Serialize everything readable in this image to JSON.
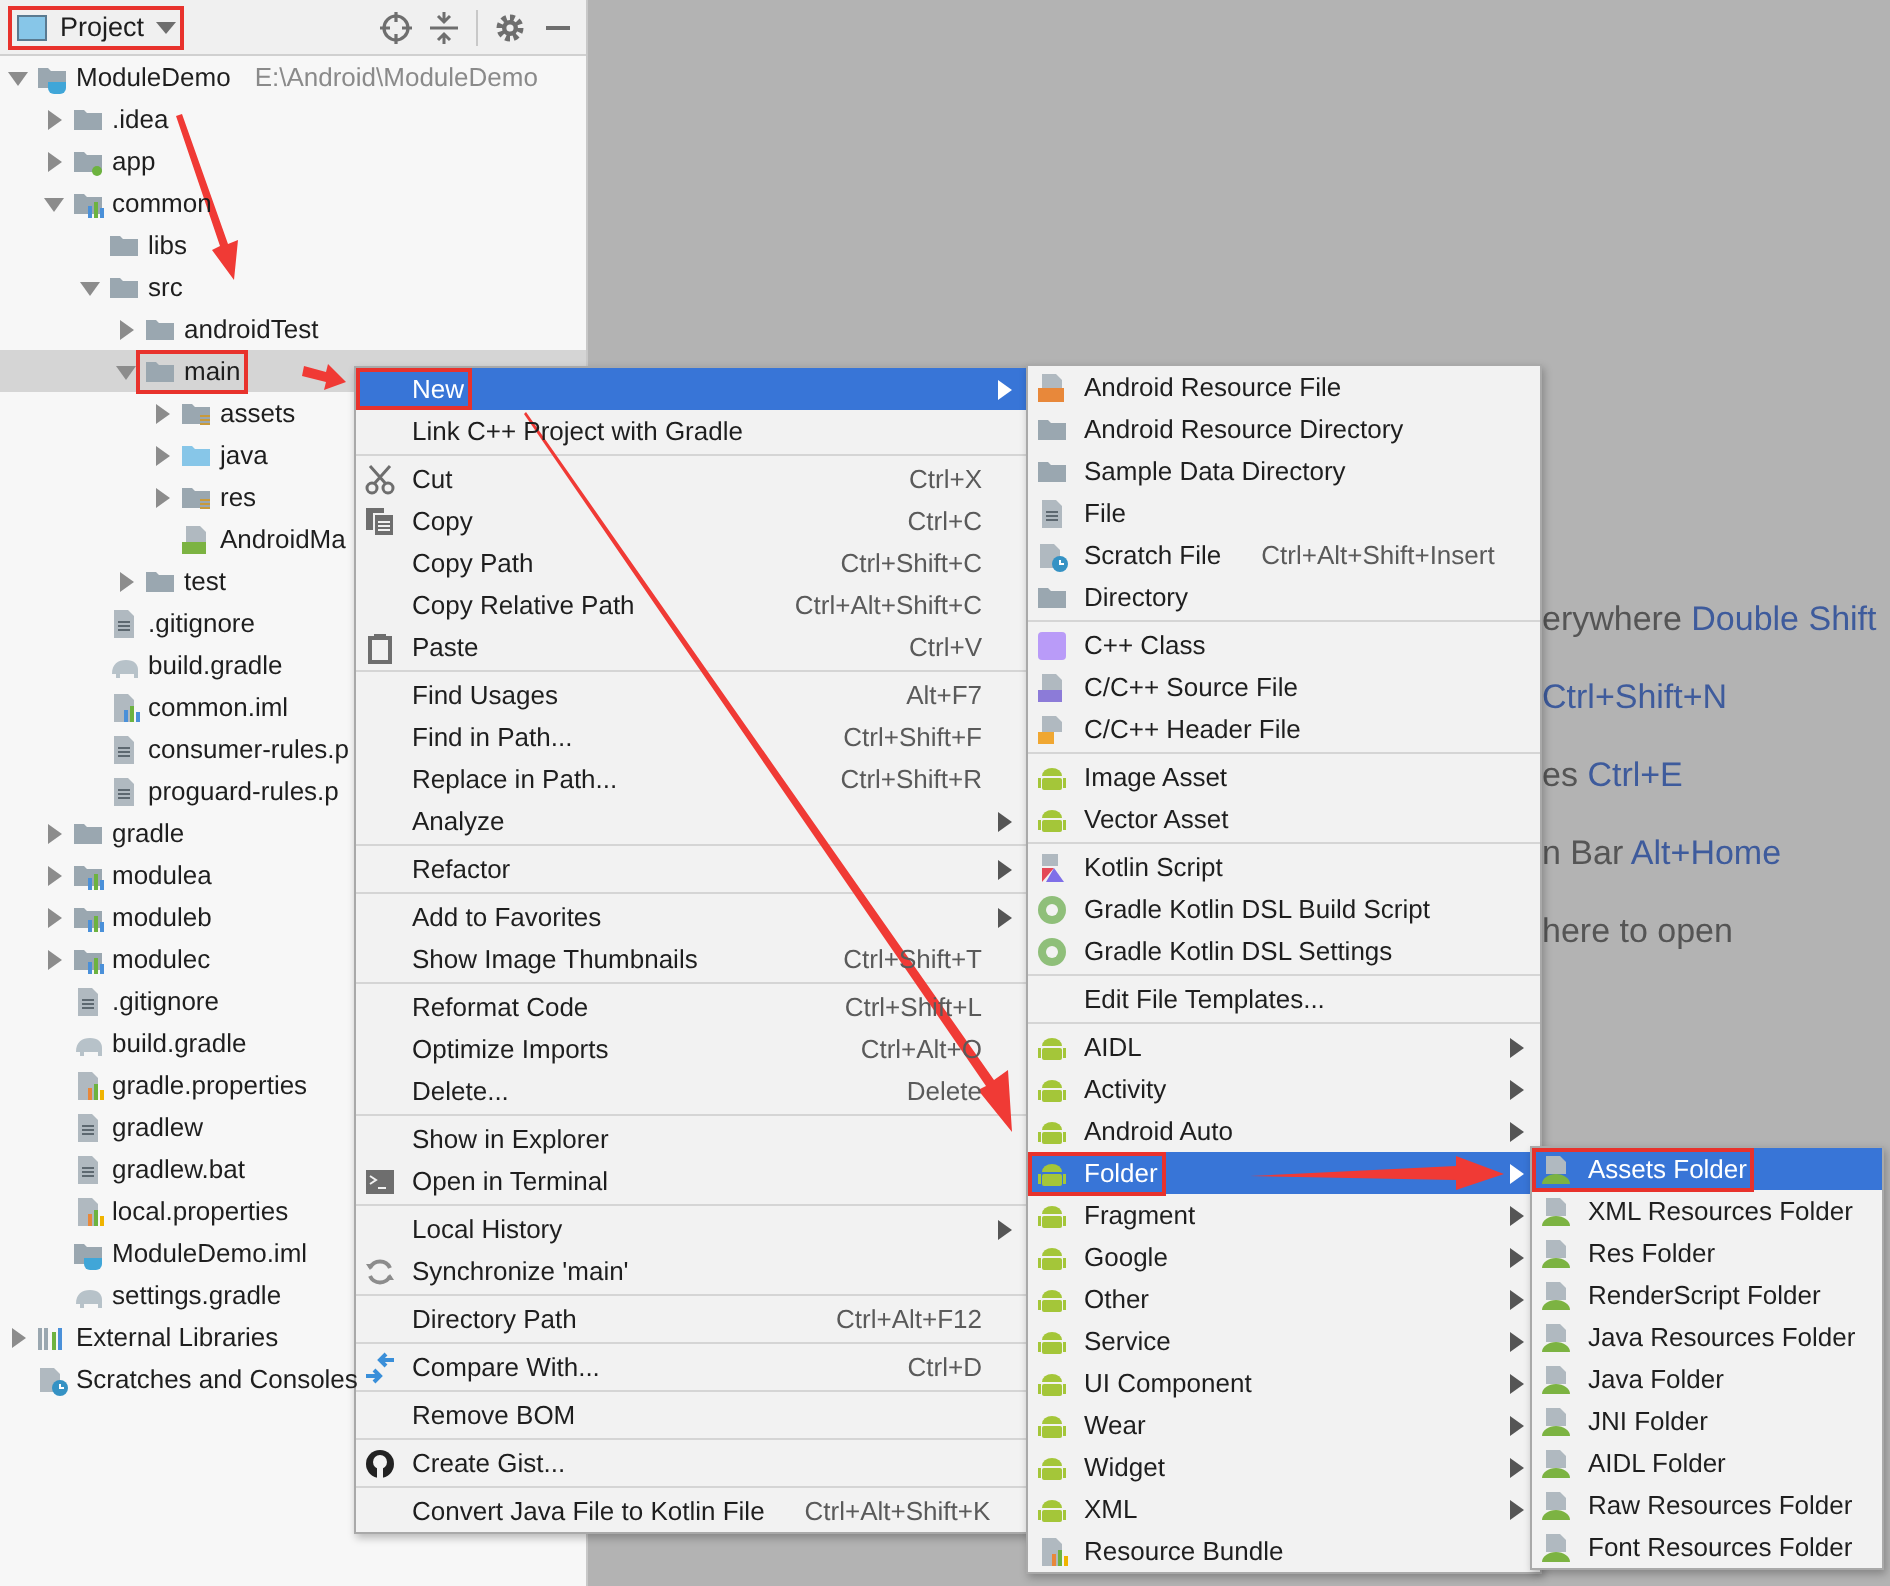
{
  "panel": {
    "view": {
      "label": "Project",
      "highlighted": true
    }
  },
  "tree": [
    {
      "label": "ModuleDemo",
      "detail": "E:\\Android\\ModuleDemo",
      "kind": "project",
      "expanded": true,
      "selected": false,
      "children": [
        {
          "label": ".idea",
          "kind": "folder",
          "expanded": false,
          "selected": false
        },
        {
          "label": "app",
          "kind": "module-app",
          "expanded": false,
          "selected": false
        },
        {
          "label": "common",
          "kind": "module",
          "expanded": true,
          "selected": false,
          "children": [
            {
              "label": "libs",
              "kind": "folder",
              "selected": false
            },
            {
              "label": "src",
              "kind": "folder",
              "expanded": true,
              "selected": false,
              "children": [
                {
                  "label": "androidTest",
                  "kind": "folder",
                  "expanded": false,
                  "selected": false
                },
                {
                  "label": "main",
                  "kind": "folder",
                  "expanded": true,
                  "selected": true,
                  "highlighted": true,
                  "children": [
                    {
                      "label": "assets",
                      "kind": "folder-res",
                      "expanded": false,
                      "selected": false
                    },
                    {
                      "label": "java",
                      "kind": "folder-blue",
                      "expanded": false,
                      "selected": false
                    },
                    {
                      "label": "res",
                      "kind": "folder-res",
                      "expanded": false,
                      "selected": false
                    },
                    {
                      "label": "AndroidMa",
                      "kind": "manifest",
                      "selected": false
                    }
                  ]
                },
                {
                  "label": "test",
                  "kind": "folder",
                  "expanded": false,
                  "selected": false
                }
              ]
            },
            {
              "label": ".gitignore",
              "kind": "file",
              "selected": false
            },
            {
              "label": "build.gradle",
              "kind": "gradle",
              "selected": false
            },
            {
              "label": "common.iml",
              "kind": "iml",
              "selected": false
            },
            {
              "label": "consumer-rules.p",
              "kind": "file",
              "selected": false
            },
            {
              "label": "proguard-rules.p",
              "kind": "file",
              "selected": false
            }
          ]
        },
        {
          "label": "gradle",
          "kind": "folder",
          "expanded": false,
          "selected": false
        },
        {
          "label": "modulea",
          "kind": "module",
          "expanded": false,
          "selected": false
        },
        {
          "label": "moduleb",
          "kind": "module",
          "expanded": false,
          "selected": false
        },
        {
          "label": "modulec",
          "kind": "module",
          "expanded": false,
          "selected": false
        },
        {
          "label": ".gitignore",
          "kind": "file",
          "selected": false
        },
        {
          "label": "build.gradle",
          "kind": "gradle",
          "selected": false
        },
        {
          "label": "gradle.properties",
          "kind": "properties",
          "selected": false
        },
        {
          "label": "gradlew",
          "kind": "file",
          "selected": false
        },
        {
          "label": "gradlew.bat",
          "kind": "file",
          "selected": false
        },
        {
          "label": "local.properties",
          "kind": "properties",
          "selected": false
        },
        {
          "label": "ModuleDemo.iml",
          "kind": "project-file",
          "selected": false
        },
        {
          "label": "settings.gradle",
          "kind": "gradle",
          "selected": false
        }
      ]
    },
    {
      "label": "External Libraries",
      "kind": "libraries",
      "expanded": false,
      "selected": false
    },
    {
      "label": "Scratches and Consoles",
      "kind": "scratches",
      "selected": false
    }
  ],
  "editor_hints": [
    {
      "text": "erywhere",
      "shortcut": "Double Shift"
    },
    {
      "shortcut": "Ctrl+Shift+N"
    },
    {
      "text": "es",
      "shortcut": "Ctrl+E"
    },
    {
      "text": "n Bar",
      "shortcut": "Alt+Home"
    },
    {
      "text": "here to open"
    }
  ],
  "context_menu": {
    "groups": [
      [
        {
          "label": "New",
          "submenu": true,
          "selected": true,
          "highlighted": true
        },
        {
          "label": "Link C++ Project with Gradle",
          "selected": false
        }
      ],
      [
        {
          "label": "Cut",
          "kind": "scissors",
          "shortcut": "Ctrl+X",
          "selected": false
        },
        {
          "label": "Copy",
          "kind": "copy",
          "shortcut": "Ctrl+C",
          "selected": false
        },
        {
          "label": "Copy Path",
          "shortcut": "Ctrl+Shift+C",
          "selected": false
        },
        {
          "label": "Copy Relative Path",
          "shortcut": "Ctrl+Alt+Shift+C",
          "selected": false
        },
        {
          "label": "Paste",
          "kind": "paste",
          "shortcut": "Ctrl+V",
          "selected": false
        }
      ],
      [
        {
          "label": "Find Usages",
          "shortcut": "Alt+F7",
          "selected": false
        },
        {
          "label": "Find in Path...",
          "shortcut": "Ctrl+Shift+F",
          "selected": false
        },
        {
          "label": "Replace in Path...",
          "shortcut": "Ctrl+Shift+R",
          "selected": false
        },
        {
          "label": "Analyze",
          "submenu": true,
          "selected": false
        }
      ],
      [
        {
          "label": "Refactor",
          "submenu": true,
          "selected": false
        }
      ],
      [
        {
          "label": "Add to Favorites",
          "submenu": true,
          "selected": false
        },
        {
          "label": "Show Image Thumbnails",
          "shortcut": "Ctrl+Shift+T",
          "selected": false
        }
      ],
      [
        {
          "label": "Reformat Code",
          "shortcut": "Ctrl+Shift+L",
          "selected": false
        },
        {
          "label": "Optimize Imports",
          "shortcut": "Ctrl+Alt+O",
          "selected": false
        },
        {
          "label": "Delete...",
          "shortcut": "Delete",
          "selected": false
        }
      ],
      [
        {
          "label": "Show in Explorer",
          "selected": false
        },
        {
          "label": "Open in Terminal",
          "kind": "terminal",
          "selected": false
        }
      ],
      [
        {
          "label": "Local History",
          "submenu": true,
          "selected": false
        },
        {
          "label": "Synchronize 'main'",
          "kind": "sync",
          "selected": false
        }
      ],
      [
        {
          "label": "Directory Path",
          "shortcut": "Ctrl+Alt+F12",
          "selected": false
        }
      ],
      [
        {
          "label": "Compare With...",
          "kind": "compare",
          "shortcut": "Ctrl+D",
          "selected": false
        }
      ],
      [
        {
          "label": "Remove BOM",
          "selected": false
        }
      ],
      [
        {
          "label": "Create Gist...",
          "kind": "github",
          "selected": false
        }
      ],
      [
        {
          "label": "Convert Java File to Kotlin File",
          "shortcut": "Ctrl+Alt+Shift+K",
          "selected": false
        }
      ]
    ]
  },
  "new_menu": {
    "groups": [
      [
        {
          "label": "Android Resource File",
          "kind": "res-file",
          "selected": false
        },
        {
          "label": "Android Resource Directory",
          "kind": "folder",
          "selected": false
        },
        {
          "label": "Sample Data Directory",
          "kind": "folder",
          "selected": false
        },
        {
          "label": "File",
          "kind": "file",
          "selected": false
        },
        {
          "label": "Scratch File",
          "kind": "scratch-file",
          "shortcut": "Ctrl+Alt+Shift+Insert",
          "selected": false
        },
        {
          "label": "Directory",
          "kind": "folder",
          "selected": false
        }
      ],
      [
        {
          "label": "C++ Class",
          "kind": "cpp-class",
          "selected": false
        },
        {
          "label": "C/C++ Source File",
          "kind": "cpp-source",
          "selected": false
        },
        {
          "label": "C/C++ Header File",
          "kind": "cpp-header",
          "selected": false
        }
      ],
      [
        {
          "label": "Image Asset",
          "kind": "android",
          "selected": false
        },
        {
          "label": "Vector Asset",
          "kind": "android",
          "selected": false
        }
      ],
      [
        {
          "label": "Kotlin Script",
          "kind": "kotlin",
          "selected": false
        },
        {
          "label": "Gradle Kotlin DSL Build Script",
          "kind": "gradle-g",
          "selected": false
        },
        {
          "label": "Gradle Kotlin DSL Settings",
          "kind": "gradle-g",
          "selected": false
        }
      ],
      [
        {
          "label": "Edit File Templates...",
          "selected": false
        }
      ],
      [
        {
          "label": "AIDL",
          "kind": "android",
          "submenu": true,
          "selected": false
        },
        {
          "label": "Activity",
          "kind": "android",
          "submenu": true,
          "selected": false
        },
        {
          "label": "Android Auto",
          "kind": "android",
          "submenu": true,
          "selected": false
        },
        {
          "label": "Folder",
          "kind": "android",
          "submenu": true,
          "selected": true,
          "highlighted": true
        },
        {
          "label": "Fragment",
          "kind": "android",
          "submenu": true,
          "selected": false
        },
        {
          "label": "Google",
          "kind": "android",
          "submenu": true,
          "selected": false
        },
        {
          "label": "Other",
          "kind": "android",
          "submenu": true,
          "selected": false
        },
        {
          "label": "Service",
          "kind": "android",
          "submenu": true,
          "selected": false
        },
        {
          "label": "UI Component",
          "kind": "android",
          "submenu": true,
          "selected": false
        },
        {
          "label": "Wear",
          "kind": "android",
          "submenu": true,
          "selected": false
        },
        {
          "label": "Widget",
          "kind": "android",
          "submenu": true,
          "selected": false
        },
        {
          "label": "XML",
          "kind": "android",
          "submenu": true,
          "selected": false
        },
        {
          "label": "Resource Bundle",
          "kind": "properties",
          "selected": false
        }
      ]
    ]
  },
  "folder_menu": {
    "groups": [
      [
        {
          "label": "Assets Folder",
          "kind": "res-folder",
          "selected": true,
          "highlighted": true
        },
        {
          "label": "XML Resources Folder",
          "kind": "res-folder",
          "selected": false
        },
        {
          "label": "Res Folder",
          "kind": "res-folder",
          "selected": false
        },
        {
          "label": "RenderScript Folder",
          "kind": "res-folder",
          "selected": false
        },
        {
          "label": "Java Resources Folder",
          "kind": "res-folder",
          "selected": false
        },
        {
          "label": "Java Folder",
          "kind": "res-folder",
          "selected": false
        },
        {
          "label": "JNI Folder",
          "kind": "res-folder",
          "selected": false
        },
        {
          "label": "AIDL Folder",
          "kind": "res-folder",
          "selected": false
        },
        {
          "label": "Raw Resources Folder",
          "kind": "res-folder",
          "selected": false
        },
        {
          "label": "Font Resources Folder",
          "kind": "res-folder",
          "selected": false
        }
      ]
    ]
  }
}
